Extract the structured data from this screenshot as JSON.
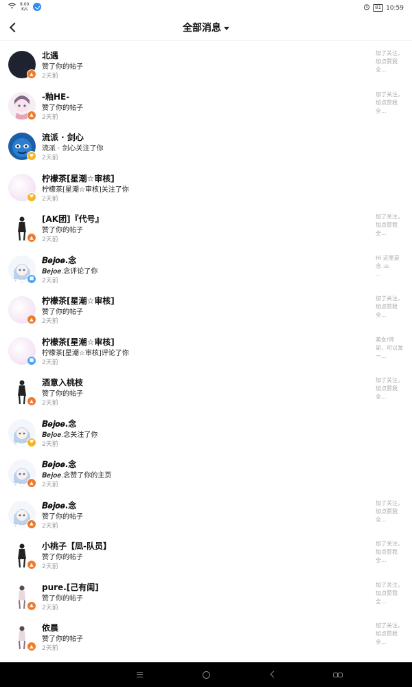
{
  "status_bar": {
    "net_speed": "8.00",
    "net_unit": "K/s",
    "battery": "81",
    "time": "10:59"
  },
  "header": {
    "title": "全部消息"
  },
  "messages": [
    {
      "name": "北遇",
      "action": "赞了你的帖子",
      "time": "2天前",
      "preview": "加了关注，\n加点赞我\n全...",
      "badge": "like",
      "avatar": "dark"
    },
    {
      "name": "-釉HE-",
      "action": "赞了你的帖子",
      "time": "2天前",
      "preview": "加了关注，\n加点赞我\n全...",
      "badge": "like",
      "avatar": "anime-pink"
    },
    {
      "name": "流派 · 剑心",
      "action": "流派 · 剑心关注了你",
      "time": "2天前",
      "preview": "",
      "badge": "follow",
      "avatar": "blue-character"
    },
    {
      "name": "柠檬茶[星潮☆审核]",
      "action": "柠檬茶[星潮☆审核]关注了你",
      "time": "2天前",
      "preview": "",
      "badge": "follow",
      "avatar": "pink-soft"
    },
    {
      "name": "[AK团]『代号』",
      "action": "赞了你的帖子",
      "time": "2天前",
      "preview": "加了关注，\n加点赞我\n全...",
      "badge": "like",
      "avatar": "figure-dark"
    },
    {
      "name": "𝑩𝒆𝒋𝒐𝒆.念",
      "action": "𝑩𝒆𝒋𝒐𝒆.念评论了你",
      "time": "2天前",
      "preview": "Hi 这里是\n念 ☁️\n...",
      "badge": "comment",
      "avatar": "anime-blue"
    },
    {
      "name": "柠檬茶[星潮☆审核]",
      "action": "赞了你的帖子",
      "time": "2天前",
      "preview": "加了关注，\n加点赞我\n全...",
      "badge": "like",
      "avatar": "pink-soft"
    },
    {
      "name": "柠檬茶[星潮☆审核]",
      "action": "柠檬茶[星潮☆审核]评论了你",
      "time": "2天前",
      "preview": "美女/帅\n哥，可以发\n一...",
      "badge": "comment",
      "avatar": "pink-soft"
    },
    {
      "name": "酒意入桃枝",
      "action": "赞了你的帖子",
      "time": "2天前",
      "preview": "加了关注，\n加点赞我\n全...",
      "badge": "like",
      "avatar": "figure-dark"
    },
    {
      "name": "𝑩𝒆𝒋𝒐𝒆.念",
      "action": "𝑩𝒆𝒋𝒐𝒆.念关注了你",
      "time": "2天前",
      "preview": "",
      "badge": "follow",
      "avatar": "anime-blue"
    },
    {
      "name": "𝑩𝒆𝒋𝒐𝒆.念",
      "action": "𝑩𝒆𝒋𝒐𝒆.念赞了你的主页",
      "time": "2天前",
      "preview": "",
      "badge": "like",
      "avatar": "anime-blue"
    },
    {
      "name": "𝑩𝒆𝒋𝒐𝒆.念",
      "action": "赞了你的帖子",
      "time": "2天前",
      "preview": "加了关注，\n加点赞我\n全...",
      "badge": "like",
      "avatar": "anime-blue"
    },
    {
      "name": "小桃子【凨-队员】",
      "action": "赞了你的帖子",
      "time": "2天前",
      "preview": "加了关注，\n加点赞我\n全...",
      "badge": "like",
      "avatar": "figure-dark"
    },
    {
      "name": "pure.[己有闺]",
      "action": "赞了你的帖子",
      "time": "2天前",
      "preview": "加了关注，\n加点赞我\n全...",
      "badge": "like",
      "avatar": "figure-light"
    },
    {
      "name": "依晨",
      "action": "赞了你的帖子",
      "time": "2天前",
      "preview": "加了关注，\n加点赞我\n全...",
      "badge": "like",
      "avatar": "figure-light"
    }
  ]
}
